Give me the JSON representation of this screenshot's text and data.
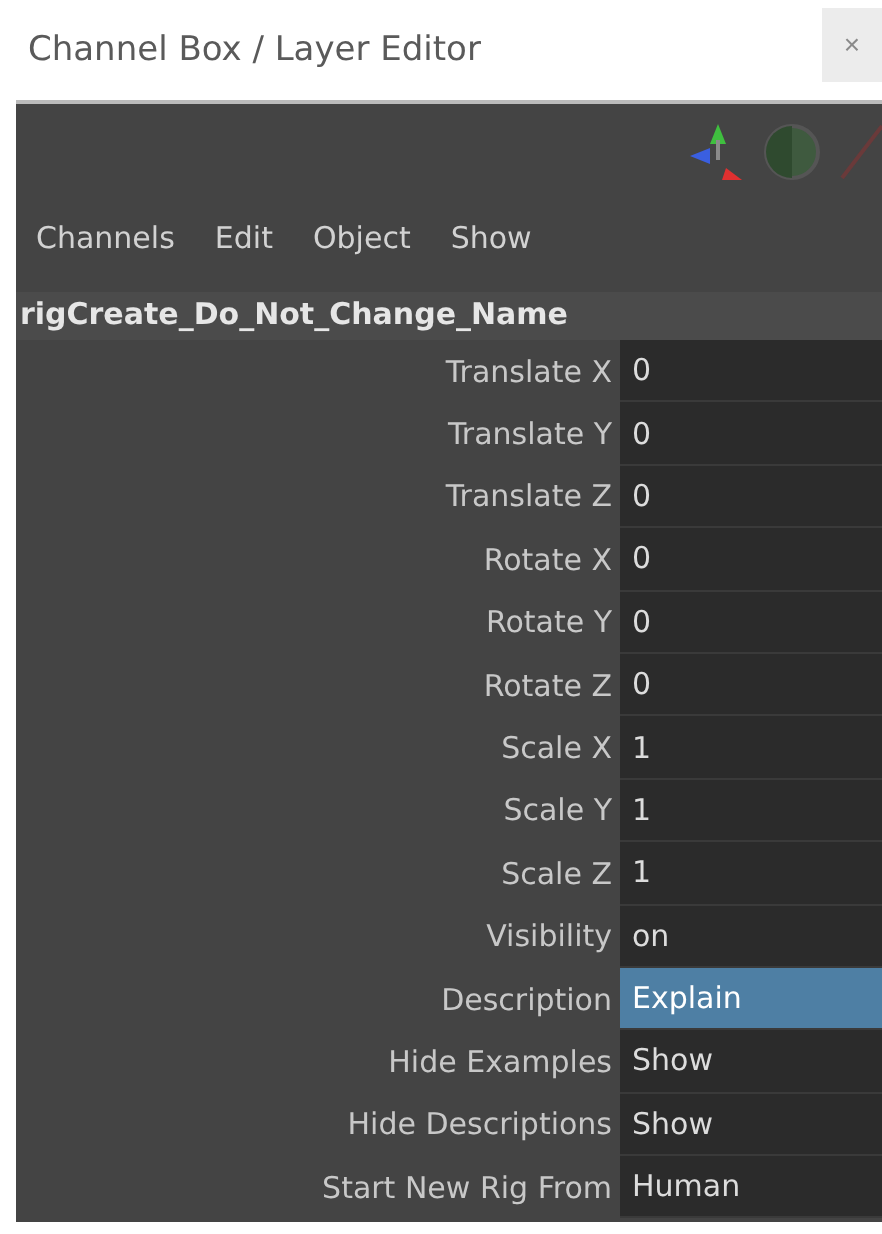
{
  "window": {
    "title": "Channel Box / Layer Editor",
    "close": "×"
  },
  "menu": [
    "Channels",
    "Edit",
    "Object",
    "Show"
  ],
  "object_name": "rigCreate_Do_Not_Change_Name",
  "channels": [
    {
      "label": "Translate X",
      "value": "0",
      "selected": false
    },
    {
      "label": "Translate Y",
      "value": "0",
      "selected": false
    },
    {
      "label": "Translate Z",
      "value": "0",
      "selected": false
    },
    {
      "label": "Rotate X",
      "value": "0",
      "selected": false
    },
    {
      "label": "Rotate Y",
      "value": "0",
      "selected": false
    },
    {
      "label": "Rotate Z",
      "value": "0",
      "selected": false
    },
    {
      "label": "Scale X",
      "value": "1",
      "selected": false
    },
    {
      "label": "Scale Y",
      "value": "1",
      "selected": false
    },
    {
      "label": "Scale Z",
      "value": "1",
      "selected": false
    },
    {
      "label": "Visibility",
      "value": "on",
      "selected": false
    },
    {
      "label": "Description",
      "value": "Explain",
      "selected": true
    },
    {
      "label": "Hide Examples",
      "value": "Show",
      "selected": false
    },
    {
      "label": "Hide Descriptions",
      "value": "Show",
      "selected": false
    },
    {
      "label": "Start New Rig From",
      "value": "Human",
      "selected": false
    }
  ]
}
